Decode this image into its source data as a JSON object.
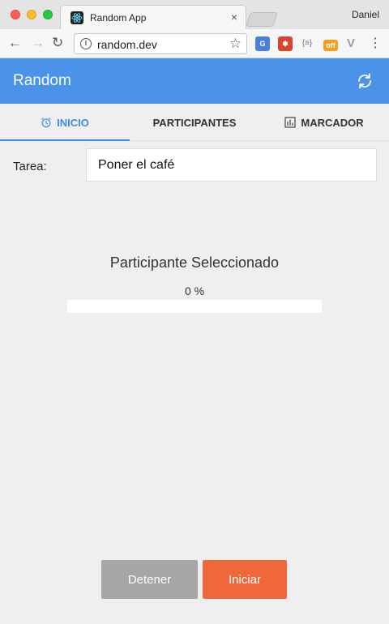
{
  "browser": {
    "tab_title": "Random App",
    "tab_close": "×",
    "profile_name": "Daniel",
    "url": "random.dev",
    "info_glyph": "i",
    "back_glyph": "←",
    "forward_glyph": "→",
    "reload_glyph": "↻",
    "star_glyph": "☆",
    "menu_glyph": "⋮",
    "extensions": {
      "translate": "G",
      "bug": "✱",
      "json": "{≡}",
      "off": "off",
      "vue": "V"
    }
  },
  "app": {
    "title": "Random",
    "accent_color": "#4a93e9"
  },
  "tabs": [
    {
      "label": "INICIO",
      "icon": "alarm-clock-icon",
      "active": true
    },
    {
      "label": "PARTICIPANTES",
      "icon": null,
      "active": false
    },
    {
      "label": "MARCADOR",
      "icon": "bar-chart-icon",
      "active": false
    }
  ],
  "task": {
    "label": "Tarea:",
    "value": "Poner el café"
  },
  "selection": {
    "title": "Participante Seleccionado",
    "progress_text": "0 %",
    "progress_fraction": 0
  },
  "buttons": {
    "stop": "Detener",
    "start": "Iniciar",
    "stop_color": "#a6a6a6",
    "start_color": "#f0673c"
  }
}
